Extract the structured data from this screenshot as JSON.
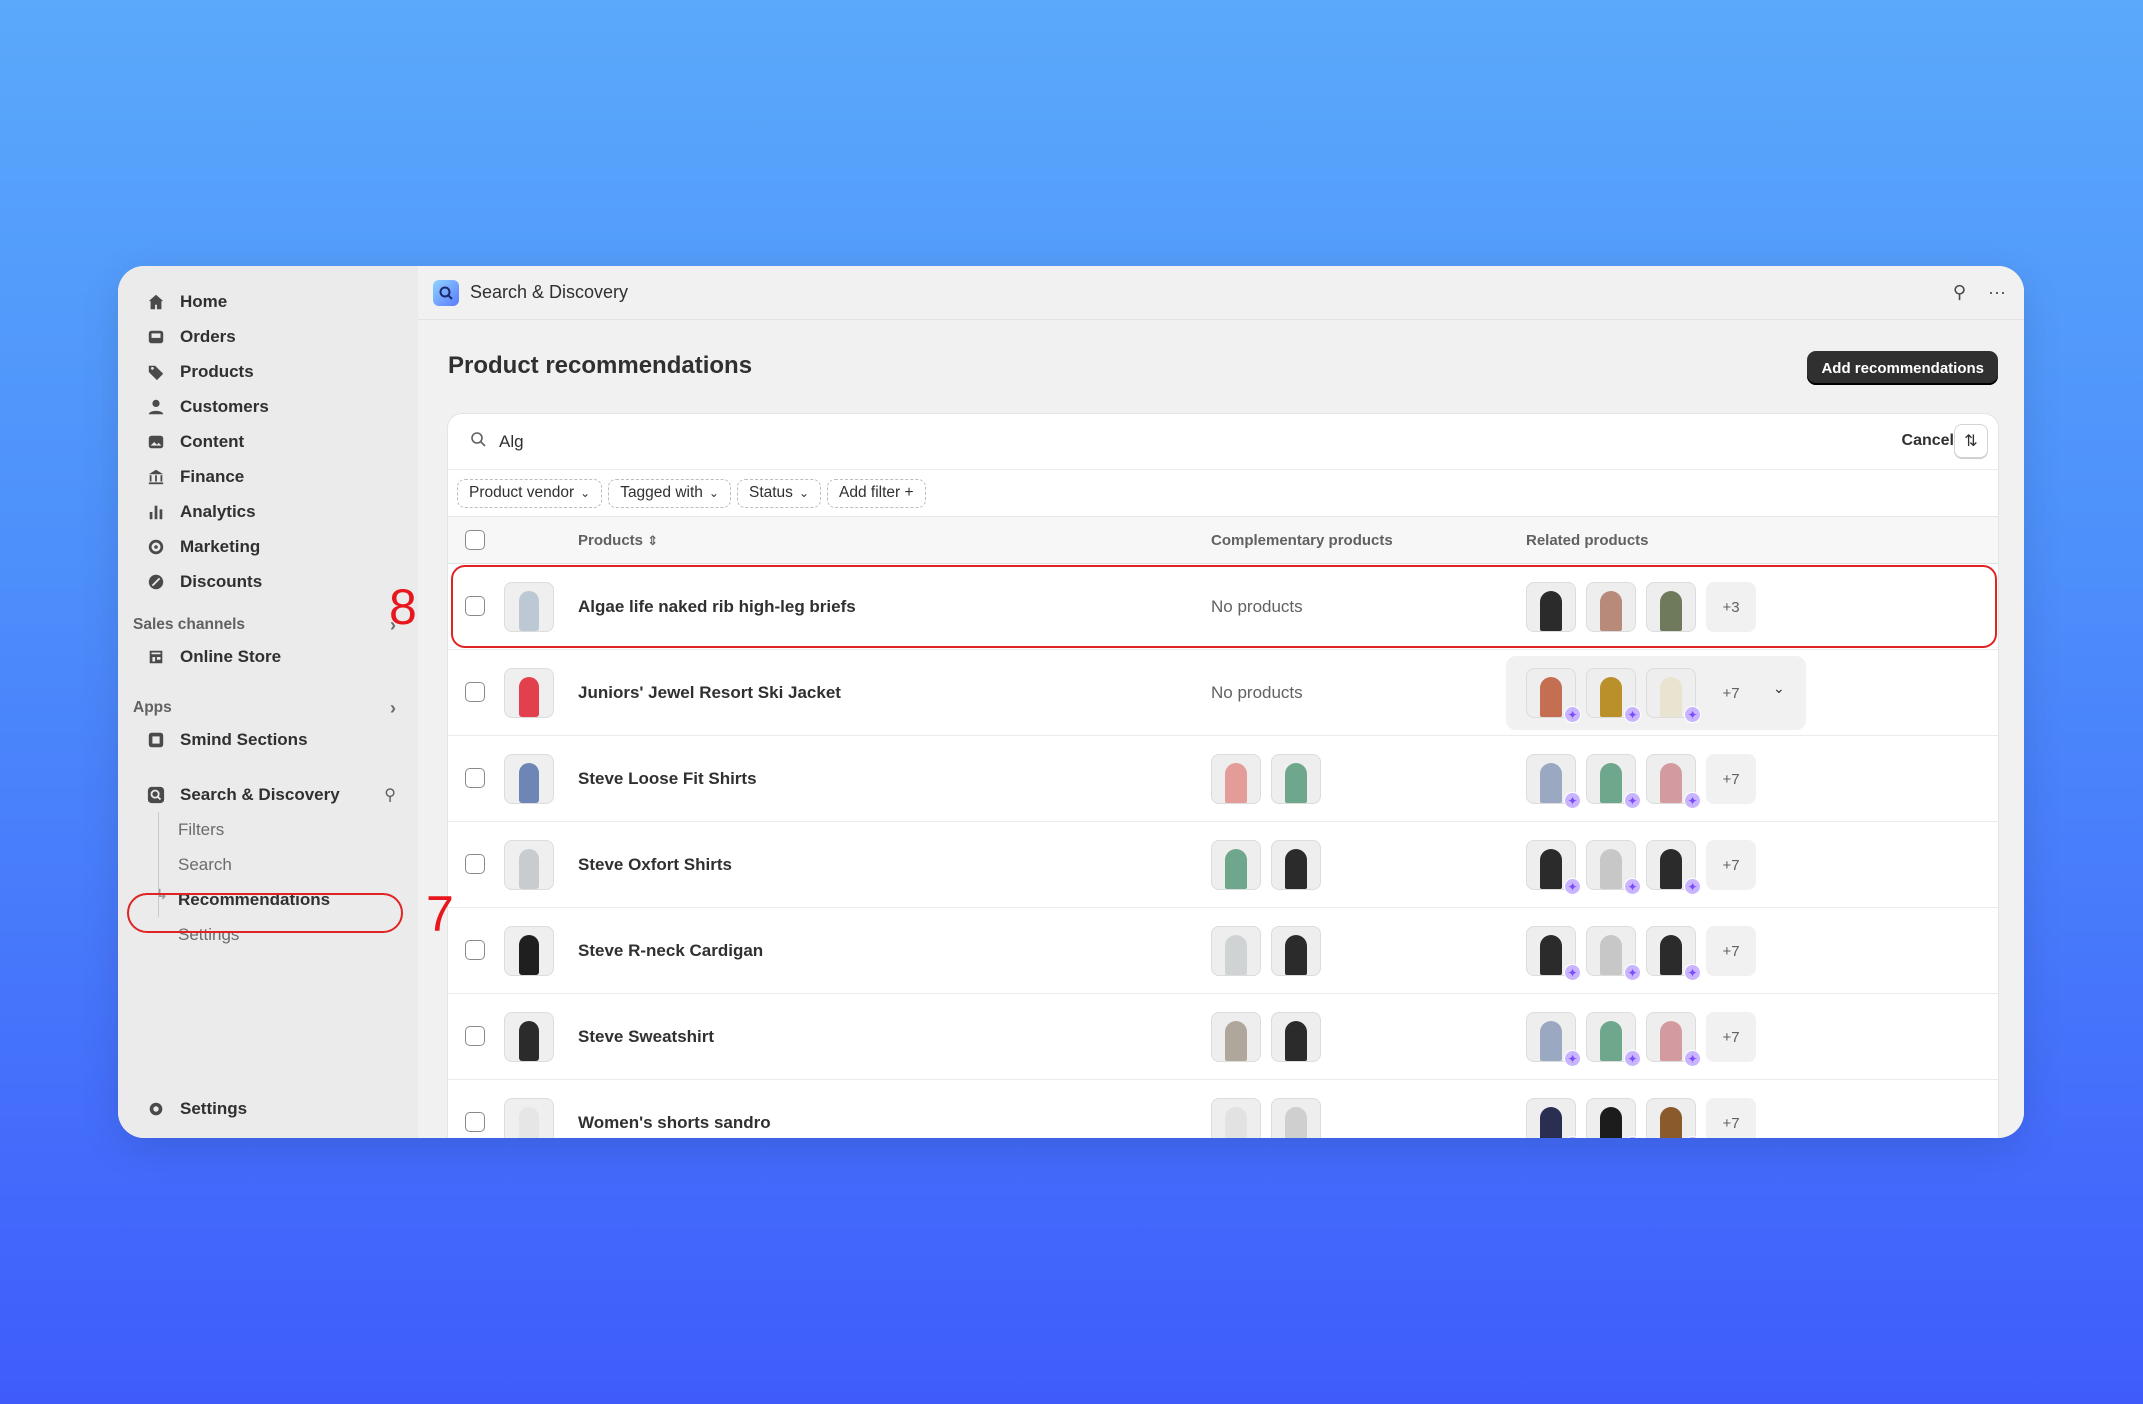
{
  "sidebar": {
    "nav": [
      {
        "label": "Home",
        "icon": "home-icon"
      },
      {
        "label": "Orders",
        "icon": "inbox-icon"
      },
      {
        "label": "Products",
        "icon": "tag-icon"
      },
      {
        "label": "Customers",
        "icon": "person-icon"
      },
      {
        "label": "Content",
        "icon": "image-icon"
      },
      {
        "label": "Finance",
        "icon": "bank-icon"
      },
      {
        "label": "Analytics",
        "icon": "bar-chart-icon"
      },
      {
        "label": "Marketing",
        "icon": "target-icon"
      },
      {
        "label": "Discounts",
        "icon": "discount-icon"
      }
    ],
    "sales_channels_label": "Sales channels",
    "online_store_label": "Online Store",
    "apps_label": "Apps",
    "smind_label": "Smind Sections",
    "search_discovery_label": "Search & Discovery",
    "sub_items": [
      "Filters",
      "Search",
      "Recommendations",
      "Settings"
    ],
    "settings_label": "Settings"
  },
  "topbar": {
    "title": "Search & Discovery"
  },
  "page": {
    "title": "Product recommendations",
    "add_button": "Add recommendations"
  },
  "search": {
    "query": "Alg",
    "cancel": "Cancel"
  },
  "filters": [
    "Product vendor",
    "Tagged with",
    "Status",
    "Add filter +"
  ],
  "table": {
    "headers": {
      "products": "Products",
      "complementary": "Complementary products",
      "related": "Related products"
    },
    "rows": [
      {
        "name": "Algae life naked rib high-leg briefs",
        "complementary": "No products",
        "comp_colors": [],
        "rel_colors": [
          "#2b2b2b",
          "#b88a7a",
          "#6f7a5c"
        ],
        "rel_spark": false,
        "more": "+3",
        "thumb": "#bcc8d4"
      },
      {
        "name": "Juniors' Jewel Resort Ski Jacket",
        "complementary": "No products",
        "comp_colors": [],
        "rel_colors": [
          "#c46e52",
          "#b9902a",
          "#e8e4d0"
        ],
        "rel_spark": true,
        "more": "+7",
        "thumb": "#e2404d"
      },
      {
        "name": "Steve Loose Fit Shirts",
        "complementary": "",
        "comp_colors": [
          "#e39c97",
          "#6fa78c"
        ],
        "rel_colors": [
          "#9aa8c2",
          "#6fa78c",
          "#d39ba0"
        ],
        "rel_spark": true,
        "more": "+7",
        "thumb": "#6e86b6"
      },
      {
        "name": "Steve Oxfort Shirts",
        "complementary": "",
        "comp_colors": [
          "#6fa78c",
          "#2b2b2b"
        ],
        "rel_colors": [
          "#2b2b2b",
          "#c7c7c7",
          "#2b2b2b"
        ],
        "rel_spark": true,
        "more": "+7",
        "thumb": "#c9ccce"
      },
      {
        "name": "Steve R-neck Cardigan",
        "complementary": "",
        "comp_colors": [
          "#cfd3d4",
          "#2b2b2b"
        ],
        "rel_colors": [
          "#2b2b2b",
          "#c7c7c7",
          "#2b2b2b"
        ],
        "rel_spark": true,
        "more": "+7",
        "thumb": "#1f1f1f"
      },
      {
        "name": "Steve Sweatshirt",
        "complementary": "",
        "comp_colors": [
          "#b0a79c",
          "#2b2b2b"
        ],
        "rel_colors": [
          "#9aa8c2",
          "#6fa78c",
          "#d39ba0"
        ],
        "rel_spark": true,
        "more": "+7",
        "thumb": "#2b2b2b"
      },
      {
        "name": "Women's shorts sandro",
        "complementary": "",
        "comp_colors": [
          "#e2e2e2",
          "#cfcfcf"
        ],
        "rel_colors": [
          "#2a2f52",
          "#1c1c1c",
          "#8a5a2b"
        ],
        "rel_spark": true,
        "more": "+7",
        "thumb": "#e6e6e6"
      }
    ]
  },
  "annotations": {
    "row_marker": "8",
    "nav_marker": "7"
  },
  "colors": {
    "highlight": "#e02424",
    "primary_button": "#303030",
    "ai_badge": "#c9b5ff"
  }
}
